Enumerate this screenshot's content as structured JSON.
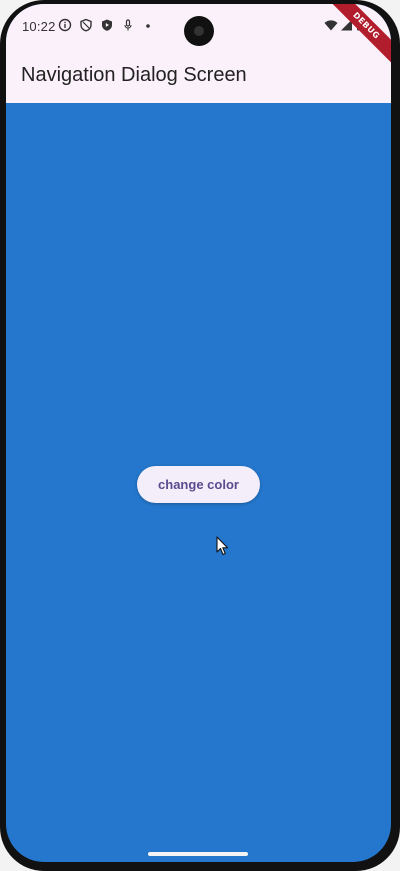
{
  "status_bar": {
    "time": "10:22",
    "icons": [
      "info-icon",
      "shield-icon",
      "shield-play-icon",
      "mic-icon",
      "dot-icon",
      "wifi-icon",
      "signal-icon",
      "battery-icon"
    ]
  },
  "debug_banner": "DEBUG",
  "app_bar": {
    "title": "Navigation Dialog Screen"
  },
  "main": {
    "button_label": "change color"
  },
  "colors": {
    "body_background": "#2477cc",
    "app_bar_background": "#fbf1fa",
    "button_background": "#f4eefa",
    "button_text": "#5a4b8f",
    "debug_banner": "#b21d2d"
  }
}
